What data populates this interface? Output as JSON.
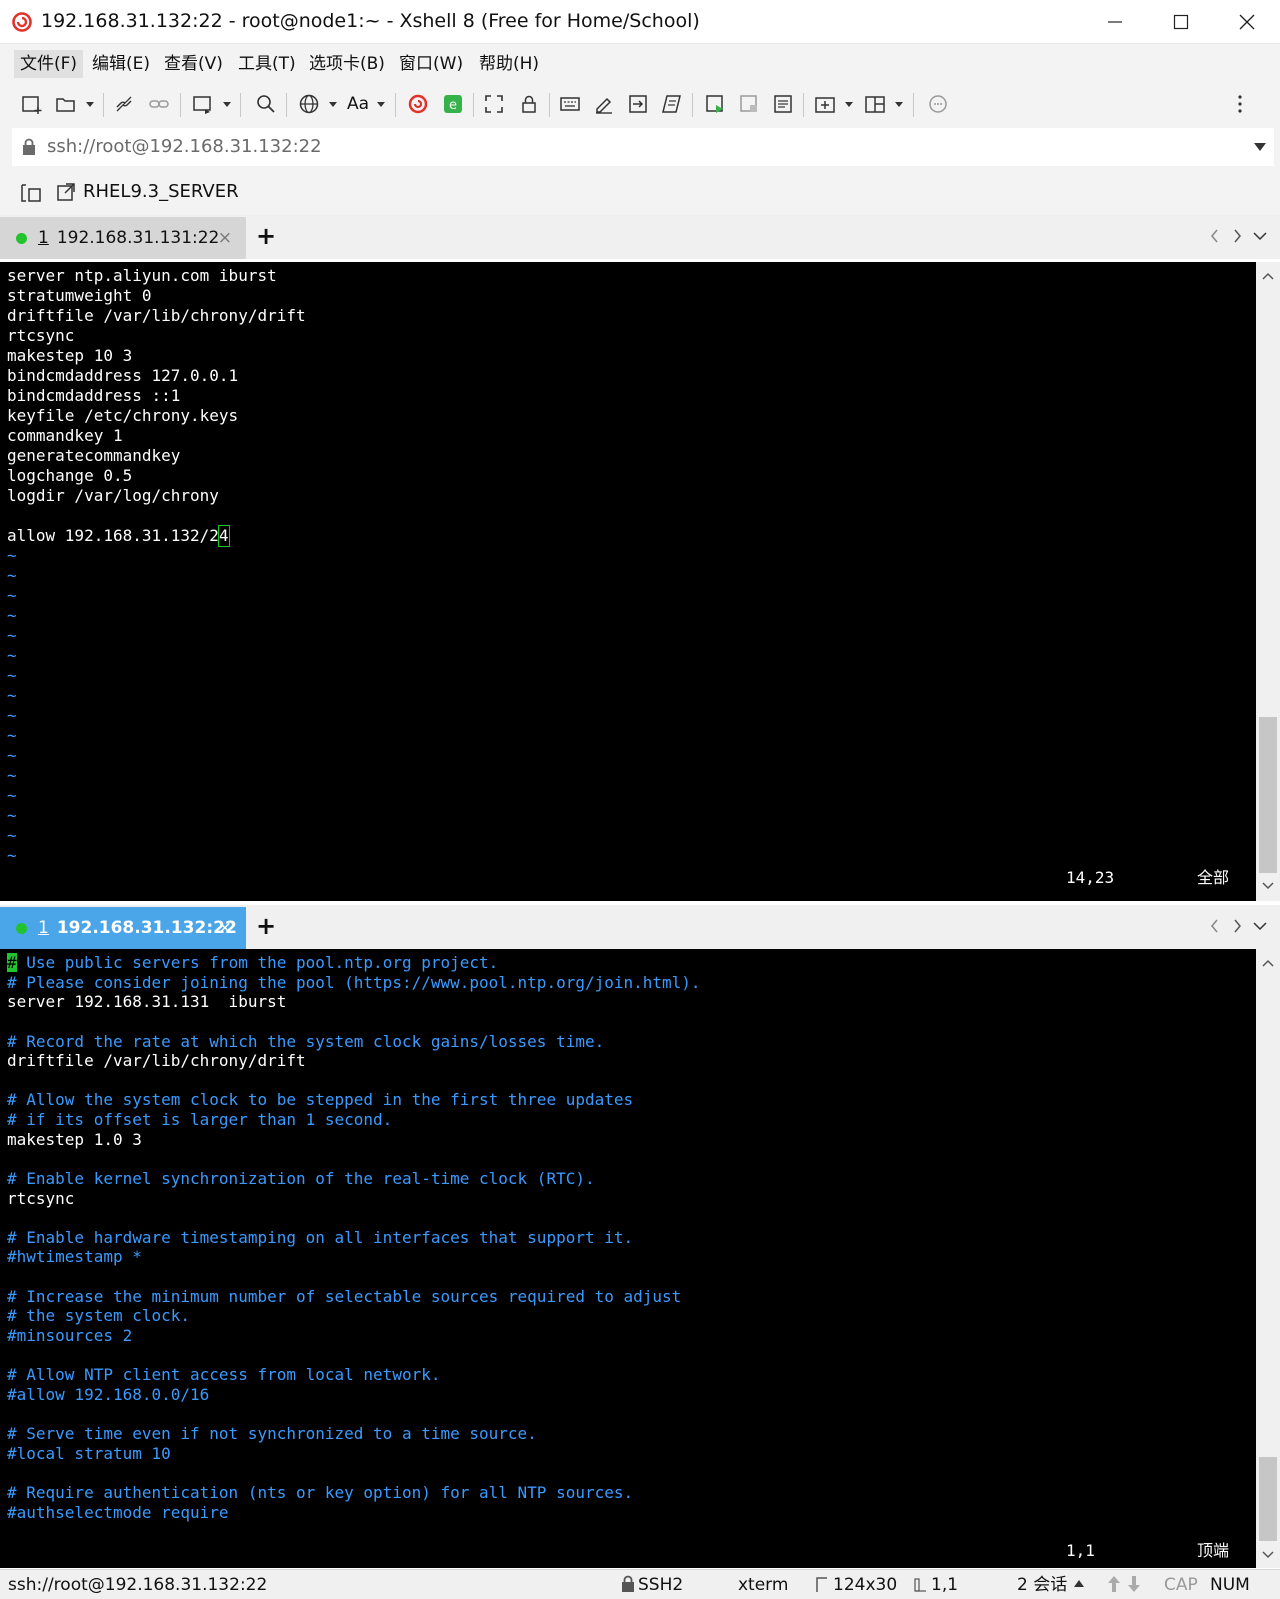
{
  "window": {
    "title": "192.168.31.132:22 - root@node1:~ - Xshell 8 (Free for Home/School)"
  },
  "menu": [
    "文件(F)",
    "编辑(E)",
    "查看(V)",
    "工具(T)",
    "选项卡(B)",
    "窗口(W)",
    "帮助(H)"
  ],
  "toolbar": {
    "font_label": "Aa"
  },
  "address": {
    "value": "ssh://root@192.168.31.132:22"
  },
  "links": {
    "session": "RHEL9.3_SERVER"
  },
  "pane_top": {
    "tab": {
      "index": "1",
      "label": "192.168.31.131:22",
      "close": "×"
    },
    "add": "+",
    "lines": [
      "server ntp.aliyun.com iburst",
      "stratumweight 0",
      "driftfile /var/lib/chrony/drift",
      "rtcsync",
      "makestep 10 3",
      "bindcmdaddress 127.0.0.1",
      "bindcmdaddress ::1",
      "keyfile /etc/chrony.keys",
      "commandkey 1",
      "generatecommandkey",
      "logchange 0.5",
      "logdir /var/log/chrony",
      "",
      "allow 192.168.31.132/2"
    ],
    "cursor_char": "4",
    "tilde": "~",
    "position": "14,23",
    "scroll": "全部"
  },
  "pane_bottom": {
    "tab": {
      "index": "1",
      "label": "192.168.31.132:22",
      "close": "×"
    },
    "add": "+",
    "first_line_cursor": "#",
    "first_line_rest": " Use public servers from the pool.ntp.org project.",
    "lines": [
      {
        "text": "# Please consider joining the pool (https://www.pool.ntp.org/join.html).",
        "comment": true
      },
      {
        "text": "server 192.168.31.131  iburst",
        "comment": false
      },
      {
        "text": "",
        "comment": false
      },
      {
        "text": "# Record the rate at which the system clock gains/losses time.",
        "comment": true
      },
      {
        "text": "driftfile /var/lib/chrony/drift",
        "comment": false
      },
      {
        "text": "",
        "comment": false
      },
      {
        "text": "# Allow the system clock to be stepped in the first three updates",
        "comment": true
      },
      {
        "text": "# if its offset is larger than 1 second.",
        "comment": true
      },
      {
        "text": "makestep 1.0 3",
        "comment": false
      },
      {
        "text": "",
        "comment": false
      },
      {
        "text": "# Enable kernel synchronization of the real-time clock (RTC).",
        "comment": true
      },
      {
        "text": "rtcsync",
        "comment": false
      },
      {
        "text": "",
        "comment": false
      },
      {
        "text": "# Enable hardware timestamping on all interfaces that support it.",
        "comment": true
      },
      {
        "text": "#hwtimestamp *",
        "comment": true
      },
      {
        "text": "",
        "comment": false
      },
      {
        "text": "# Increase the minimum number of selectable sources required to adjust",
        "comment": true
      },
      {
        "text": "# the system clock.",
        "comment": true
      },
      {
        "text": "#minsources 2",
        "comment": true
      },
      {
        "text": "",
        "comment": false
      },
      {
        "text": "# Allow NTP client access from local network.",
        "comment": true
      },
      {
        "text": "#allow 192.168.0.0/16",
        "comment": true
      },
      {
        "text": "",
        "comment": false
      },
      {
        "text": "# Serve time even if not synchronized to a time source.",
        "comment": true
      },
      {
        "text": "#local stratum 10",
        "comment": true
      },
      {
        "text": "",
        "comment": false
      },
      {
        "text": "# Require authentication (nts or key option) for all NTP sources.",
        "comment": true
      },
      {
        "text": "#authselectmode require",
        "comment": true
      }
    ],
    "position": "1,1",
    "scroll": "顶端"
  },
  "status": {
    "connection": "ssh://root@192.168.31.132:22",
    "protocol": "SSH2",
    "terminal": "xterm",
    "size": "124x30",
    "cursor": "1,1",
    "sessions": "2 会话",
    "cap": "CAP",
    "num": "NUM"
  },
  "colors": {
    "comment": "#3b9aff",
    "cursor": "#22c32e",
    "active_tab": "#4aa6e8",
    "status_dot": "#22c32e"
  }
}
